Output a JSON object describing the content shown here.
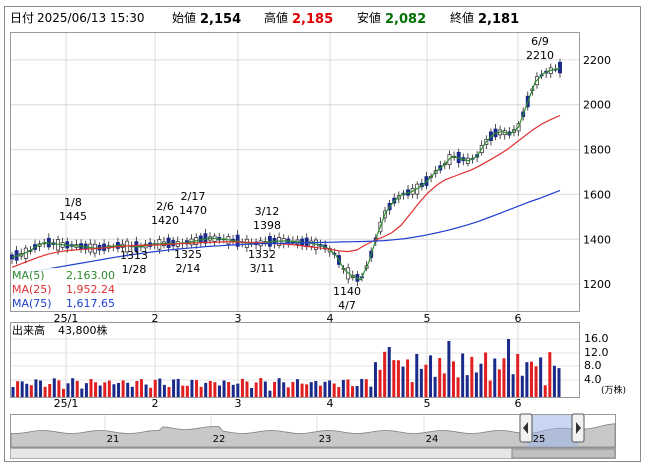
{
  "header": {
    "date_label": "日付",
    "date_value": "2025/06/13 15:30",
    "open_label": "始値",
    "open_value": "2,154",
    "high_label": "高値",
    "high_value": "2,185",
    "low_label": "安値",
    "low_value": "2,082",
    "close_label": "終値",
    "close_value": "2,181",
    "colors": {
      "high": "#e00000",
      "low": "#007000"
    }
  },
  "legend": [
    {
      "label": "MA(5)",
      "value": "2,163.00",
      "color": "#2e8b2e"
    },
    {
      "label": "MA(25)",
      "value": "1,952.24",
      "color": "#e03030"
    },
    {
      "label": "MA(75)",
      "value": "1,617.65",
      "color": "#2040d0"
    }
  ],
  "volume_panel": {
    "label": "出来高",
    "value": "43,800株",
    "unit": "(万株)",
    "y_ticks": [
      "16.0",
      "12.0",
      "8.0",
      "4.0"
    ]
  },
  "nav": {
    "months": [
      "21",
      "22",
      "23",
      "24",
      "25"
    ]
  },
  "chart_data": {
    "type": "candlestick",
    "ylim": [
      1080,
      2320
    ],
    "y_ticks": [
      1200,
      1400,
      1600,
      1800,
      2000,
      2200
    ],
    "x_ticks": [
      "25/1",
      "2",
      "3",
      "4",
      "5",
      "6"
    ],
    "annotations": [
      {
        "top": "1/8",
        "bottom": "1445"
      },
      {
        "top": "2/6",
        "bottom": "1420"
      },
      {
        "top": "2/17",
        "bottom": "1470"
      },
      {
        "top": "3/12",
        "bottom": "1398"
      },
      {
        "top": "6/9",
        "bottom": "2210"
      },
      {
        "top": "1313",
        "bottom": "1/28"
      },
      {
        "top": "1325",
        "bottom": "2/14"
      },
      {
        "top": "1332",
        "bottom": "3/11"
      },
      {
        "top": "1140",
        "bottom": "4/7"
      }
    ],
    "series": [
      {
        "name": "MA(5)",
        "color": "#2e8b2e",
        "values": [
          1320,
          1330,
          1345,
          1370,
          1385,
          1380,
          1376,
          1372,
          1370,
          1365,
          1360,
          1362,
          1368,
          1372,
          1370,
          1366,
          1370,
          1378,
          1380,
          1382,
          1380,
          1385,
          1392,
          1400,
          1405,
          1402,
          1398,
          1392,
          1385,
          1380,
          1383,
          1388,
          1392,
          1393,
          1390,
          1386,
          1382,
          1375,
          1360,
          1330,
          1265,
          1235,
          1220,
          1300,
          1420,
          1520,
          1570,
          1600,
          1610,
          1630,
          1660,
          1700,
          1730,
          1770,
          1760,
          1750,
          1770,
          1830,
          1870,
          1880,
          1870,
          1900,
          2000,
          2100,
          2140,
          2155,
          2163
        ]
      },
      {
        "name": "MA(25)",
        "color": "#e03030",
        "values": [
          1275,
          1290,
          1305,
          1320,
          1333,
          1342,
          1348,
          1352,
          1355,
          1357,
          1360,
          1363,
          1367,
          1370,
          1372,
          1373,
          1374,
          1376,
          1378,
          1380,
          1382,
          1384,
          1386,
          1387,
          1388,
          1388,
          1387,
          1386,
          1384,
          1382,
          1380,
          1378,
          1375,
          1370,
          1365,
          1360,
          1355,
          1348,
          1345,
          1352,
          1375,
          1395,
          1410,
          1430,
          1462,
          1510,
          1560,
          1605,
          1640,
          1665,
          1680,
          1695,
          1710,
          1730,
          1752,
          1775,
          1800,
          1830,
          1860,
          1890,
          1915,
          1935,
          1952
        ]
      },
      {
        "name": "MA(75)",
        "color": "#2040d0",
        "values": [
          1240,
          1248,
          1256,
          1264,
          1272,
          1280,
          1288,
          1296,
          1304,
          1312,
          1320,
          1327,
          1334,
          1340,
          1346,
          1351,
          1356,
          1360,
          1364,
          1368,
          1371,
          1374,
          1376,
          1378,
          1380,
          1381,
          1382,
          1383,
          1384,
          1385,
          1386,
          1387,
          1388,
          1389,
          1390,
          1392,
          1394,
          1398,
          1403,
          1410,
          1418,
          1428,
          1438,
          1450,
          1463,
          1478,
          1495,
          1512,
          1530,
          1548,
          1566,
          1582,
          1600,
          1618
        ]
      }
    ]
  }
}
